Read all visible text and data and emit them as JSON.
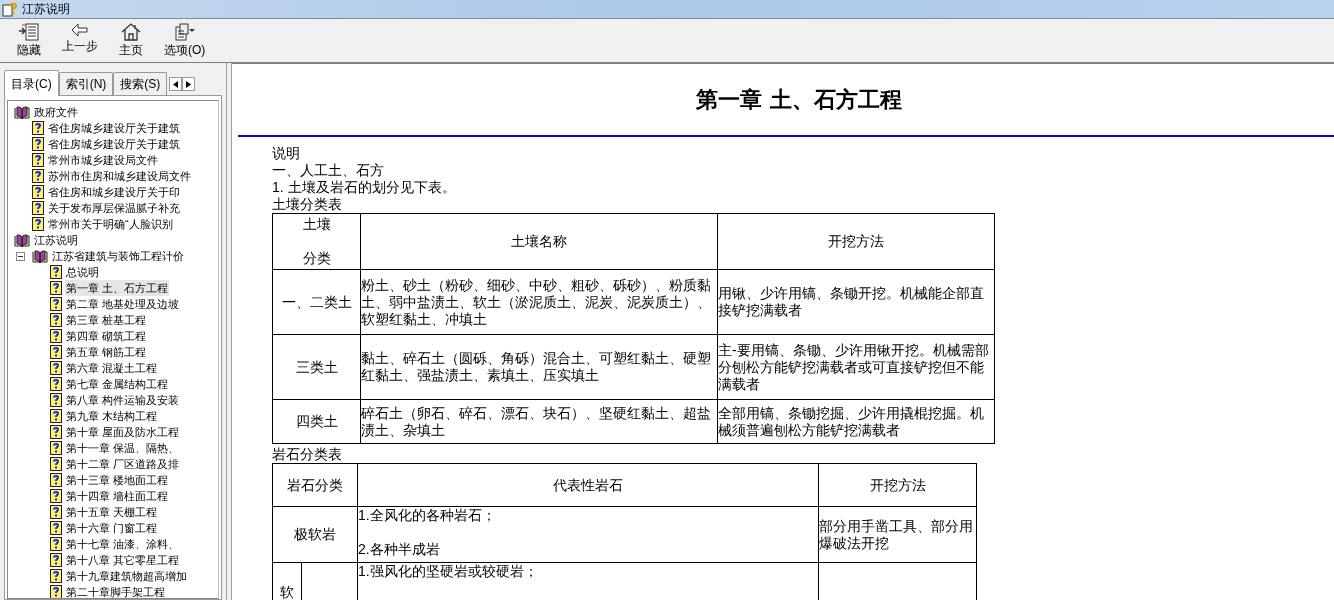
{
  "window": {
    "title": "江苏说明"
  },
  "toolbar": [
    {
      "kind": "hide",
      "label": "隐藏"
    },
    {
      "kind": "back",
      "label": "上一步"
    },
    {
      "kind": "home",
      "label": "主页"
    },
    {
      "kind": "options",
      "label": "选项(O)"
    }
  ],
  "tabs": [
    {
      "label": "目录(C)",
      "selected": true
    },
    {
      "label": "索引(N)",
      "selected": false
    },
    {
      "label": "搜索(S)",
      "selected": false
    }
  ],
  "tree": [
    {
      "kind": "book",
      "label": "政府文件",
      "children": [
        {
          "kind": "page",
          "label": "省住房城乡建设厅关于建筑",
          "selected": false
        },
        {
          "kind": "page",
          "label": "省住房城乡建设厅关于建筑",
          "selected": false
        },
        {
          "kind": "page",
          "label": "常州市城乡建设局文件",
          "selected": false
        },
        {
          "kind": "page",
          "label": "苏州市住房和城乡建设局文件",
          "selected": false
        },
        {
          "kind": "page",
          "label": "省住房和城乡建设厅关于印",
          "selected": false
        },
        {
          "kind": "page",
          "label": "关于发布厚层保温腻子补充",
          "selected": false
        },
        {
          "kind": "page",
          "label": "常州市关于明确“人脸识别",
          "selected": false
        }
      ]
    },
    {
      "kind": "book",
      "label": "江苏说明",
      "children": [
        {
          "kind": "book",
          "label": "江苏省建筑与装饰工程计价",
          "expanded": true,
          "children": [
            {
              "kind": "page",
              "label": "总说明",
              "selected": false
            },
            {
              "kind": "page",
              "label": "第一章  土、石方工程",
              "selected": true
            },
            {
              "kind": "page",
              "label": "第二章  地基处理及边坡",
              "selected": false
            },
            {
              "kind": "page",
              "label": "第三章  桩基工程",
              "selected": false
            },
            {
              "kind": "page",
              "label": "第四章  砌筑工程",
              "selected": false
            },
            {
              "kind": "page",
              "label": "第五章  钢筋工程",
              "selected": false
            },
            {
              "kind": "page",
              "label": "第六章  混凝土工程",
              "selected": false
            },
            {
              "kind": "page",
              "label": "第七章  金属结构工程",
              "selected": false
            },
            {
              "kind": "page",
              "label": "第八章  构件运输及安装",
              "selected": false
            },
            {
              "kind": "page",
              "label": "第九章  木结构工程",
              "selected": false
            },
            {
              "kind": "page",
              "label": "第十章  屋面及防水工程",
              "selected": false
            },
            {
              "kind": "page",
              "label": "第十一章  保温、隔热、",
              "selected": false
            },
            {
              "kind": "page",
              "label": "第十二章  厂区道路及排",
              "selected": false
            },
            {
              "kind": "page",
              "label": "第十三章  楼地面工程",
              "selected": false
            },
            {
              "kind": "page",
              "label": "第十四章  墙柱面工程",
              "selected": false
            },
            {
              "kind": "page",
              "label": "第十五章  天棚工程",
              "selected": false
            },
            {
              "kind": "page",
              "label": "第十六章  门窗工程",
              "selected": false
            },
            {
              "kind": "page",
              "label": "第十七章  油漆、涂料、",
              "selected": false
            },
            {
              "kind": "page",
              "label": "第十八章  其它零星工程",
              "selected": false
            },
            {
              "kind": "page",
              "label": "第十九章建筑物超高增加",
              "selected": false
            },
            {
              "kind": "page",
              "label": "第二十章脚手架工程",
              "selected": false
            }
          ]
        }
      ]
    }
  ],
  "document": {
    "heading": "第一章  土、石方工程",
    "intro": [
      "说明",
      "一、人工土、石方",
      "1. 土壤及岩石的划分见下表。"
    ],
    "soil_caption": "土壤分类表",
    "soil_table": {
      "columns": [
        [
          "土壤",
          "分类"
        ],
        [
          "土壤名称"
        ],
        [
          "开挖方法"
        ]
      ],
      "rows": [
        {
          "class": "一、二类土",
          "names": "粉土、砂土（粉砂、细砂、中砂、粗砂、砾砂）、粉质黏土、弱中盐渍土、软土（淤泥质土、泥炭、泥炭质土）、软塑红黏土、冲填土",
          "method": "用锹、少许用镐、条锄开挖。机械能企部直接铲挖满载者"
        },
        {
          "class": "三类土",
          "names": "黏土、碎石土（圆砾、角砾）混合土、可塑红黏土、硬塑红黏土、强盐渍土、素填土、压实填土",
          "method": "主-要用镐、条锄、少许用锹开挖。机械需部分刨松方能铲挖满载者或可直接铲挖但不能满载者"
        },
        {
          "class": "四类土",
          "names": "碎石土（卵石、碎石、漂石、块石）、坚硬红黏土、超盐渍土、杂填土",
          "method": "全部用镐、条锄挖掘、少许用撬棍挖掘。机械须普遍刨松方能铲挖满载者"
        }
      ]
    },
    "rock_caption": "岩石分类表",
    "rock_table": {
      "columns": [
        "岩石分类",
        "代表性岩石",
        "开挖方法"
      ],
      "rows": [
        {
          "kind": "single",
          "class": "极软岩",
          "rocks": [
            "1.全风化的各种岩石；",
            "2.各种半成岩"
          ],
          "method": "部分用手凿工具、部分用爆破法开挖"
        },
        {
          "kind": "split",
          "class": "软",
          "rocks": [
            "1.强风化的坚硬岩或较硬岩；"
          ]
        }
      ]
    }
  }
}
